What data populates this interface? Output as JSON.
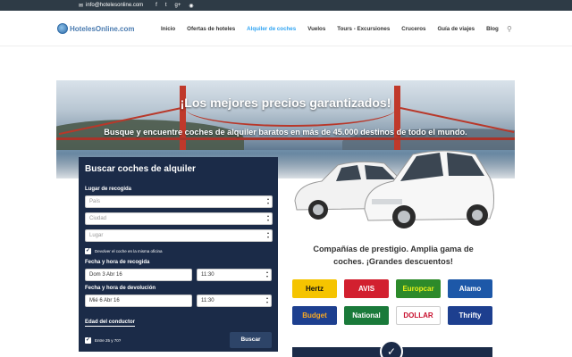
{
  "topbar": {
    "email": "info@hotelesonline.com",
    "social": [
      "f",
      "t",
      "g+",
      "rss"
    ]
  },
  "logo": {
    "text": "HotelesOnline.com"
  },
  "nav": {
    "items": [
      "Inicio",
      "Ofertas de hoteles",
      "Alquiler de coches",
      "Vuelos",
      "Tours - Excursiones",
      "Cruceros",
      "Guía de viajes",
      "Blog"
    ],
    "active": "Alquiler de coches"
  },
  "hero": {
    "headline": "¡Los mejores precios garantizados!",
    "subline": "Busque y encuentre coches de alquiler baratos en más de 45.000 destinos de todo el mundo."
  },
  "search_form": {
    "title": "Buscar coches de alquiler",
    "pickup_label": "Lugar de recogida",
    "country_placeholder": "País",
    "city_placeholder": "Ciudad",
    "place_placeholder": "Lugar",
    "same_office_label": "Devolver el coche en la misma oficina",
    "pickup_datetime_label": "Fecha y hora de recogida",
    "pickup_date": "Dom 3 Abr 16",
    "pickup_time": "11:30",
    "return_datetime_label": "Fecha y hora de devolución",
    "return_date": "Mié 6 Abr 16",
    "return_time": "11:30",
    "driver_age_label": "Edad del conductor",
    "age_checkbox_label": "Entre 25 y 70?",
    "search_button": "Buscar"
  },
  "promo": {
    "line1": "Compañías de prestigio. Amplia gama de",
    "line2": "coches. ¡Grandes descuentos!"
  },
  "companies": [
    {
      "name": "Hertz",
      "bg": "#f5c400",
      "fg": "#111111"
    },
    {
      "name": "AVIS",
      "bg": "#d2202f",
      "fg": "#ffffff"
    },
    {
      "name": "Europcar",
      "bg": "#2d8a2a",
      "fg": "#e8f01a"
    },
    {
      "name": "Alamo",
      "bg": "#1d58a8",
      "fg": "#ffffff"
    },
    {
      "name": "Budget",
      "bg": "#1d3f8f",
      "fg": "#f7a823"
    },
    {
      "name": "National",
      "bg": "#1a7a3a",
      "fg": "#ffffff"
    },
    {
      "name": "DOLLAR",
      "bg": "#ffffff",
      "fg": "#c8102e"
    },
    {
      "name": "Thrifty",
      "bg": "#1d3f8f",
      "fg": "#ffffff"
    }
  ],
  "colors": {
    "accent": "#2ea3f2",
    "form_bg": "#1b2b48",
    "topbar_bg": "#2e3b46"
  }
}
